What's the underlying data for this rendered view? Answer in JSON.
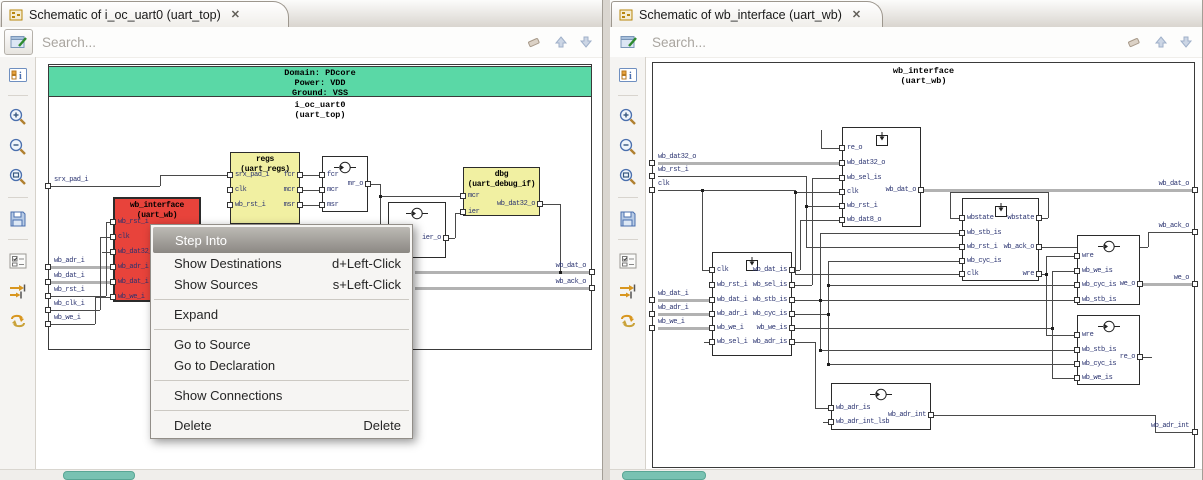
{
  "colors": {
    "banner_green": "#5ad8a6",
    "block_yellow": "#f1f0a2",
    "block_red": "#e8433b",
    "scroll_thumb": "#79c2b2",
    "accent_gold": "#d8961f"
  },
  "left_pane": {
    "tab_title": "Schematic of i_oc_uart0 (uart_top)",
    "close_glyph": "✕",
    "search_placeholder": "Search...",
    "banner": [
      "Domain: PDcore",
      "Power: VDD",
      "Ground: VSS"
    ],
    "instance": [
      "i_oc_uart0",
      "(uart_top)"
    ],
    "edge_in": [
      "srx_pad_i",
      "wb_adr_i",
      "wb_dat_i",
      "wb_rst_i",
      "wb_clk_i",
      "wb_we_i"
    ],
    "edge_out": [
      "wb_dat_o",
      "wb_ack_o"
    ],
    "blocks": {
      "regs": {
        "t": "regs",
        "s": "(uart_regs)",
        "l": [
          "srx_pad_i",
          "clk",
          "wb_rst_i"
        ],
        "r": [
          "fcr",
          "mcr",
          "msr"
        ]
      },
      "clkgen1": {
        "t": "",
        "s": "",
        "l": [
          "fcr",
          "mcr",
          "msr"
        ],
        "r": [
          "mr_o"
        ]
      },
      "clkgen2": {
        "t": "",
        "s": "",
        "l": [],
        "r": [
          "ier_o"
        ]
      },
      "dbg": {
        "t": "dbg",
        "s": "(uart_debug_if)",
        "l": [
          "mcr",
          "ier"
        ],
        "r": [
          "wb_dat32_o"
        ]
      },
      "wb": {
        "t": "wb_interface",
        "s": "(uart_wb)",
        "l": [
          "wb_rst_i",
          "clk",
          "wb_dat32_o",
          "wb_adr_i",
          "wb_dat_i",
          "wb_we_i"
        ],
        "r": []
      }
    },
    "context_menu": {
      "items": [
        {
          "label": "Step Into",
          "accel": "",
          "selected": true
        },
        {
          "label": "Show Destinations",
          "accel": "d+Left-Click"
        },
        {
          "label": "Show Sources",
          "accel": "s+Left-Click"
        },
        {
          "sep": true
        },
        {
          "label": "Expand",
          "accel": ""
        },
        {
          "sep": true
        },
        {
          "label": "Go to Source",
          "accel": ""
        },
        {
          "label": "Go to Declaration",
          "accel": ""
        },
        {
          "sep": true
        },
        {
          "label": "Show Connections",
          "accel": ""
        },
        {
          "sep": true
        },
        {
          "label": "Delete",
          "accel": "Delete"
        }
      ]
    }
  },
  "right_pane": {
    "tab_title": "Schematic of wb_interface (uart_wb)",
    "close_glyph": "✕",
    "search_placeholder": "Search...",
    "title": [
      "wb_interface",
      "(uart_wb)"
    ],
    "edge_in": [
      "wb_dat32_o",
      "wb_rst_i",
      "clk",
      "wb_dat_i",
      "wb_adr_i",
      "wb_we_i"
    ],
    "edge_out": [
      "wb_dat_o",
      "wb_ack_o",
      "we_o",
      "wb_adr_int"
    ],
    "blocks": {
      "top": {
        "t": "",
        "s": "",
        "l": [
          "re_o",
          "wb_dat32_o",
          "wb_sel_is",
          "clk",
          "wb_rst_i",
          "wb_dat8_o"
        ],
        "r": [
          "wb_dat_o"
        ]
      },
      "inreg": {
        "t": "",
        "s": "",
        "l": [
          "clk",
          "wb_rst_i",
          "wb_dat_i",
          "wb_adr_i",
          "wb_we_i",
          "wb_sel_i"
        ],
        "r": [
          "wb_dat_is",
          "wb_sel_is",
          "wb_stb_is",
          "wb_cyc_is",
          "wb_we_is",
          "wb_adr_is"
        ]
      },
      "state": {
        "t": "",
        "s": "",
        "l": [
          "wbstate",
          "wb_stb_is",
          "wb_rst_i",
          "wb_cyc_is",
          "clk"
        ],
        "r": [
          "wbstate",
          "wb_ack_o",
          "wre"
        ]
      },
      "weff": {
        "t": "",
        "s": "",
        "l": [
          "wre",
          "wb_we_is",
          "wb_cyc_is",
          "wb_stb_is"
        ],
        "r": [
          "we_o"
        ]
      },
      "reff": {
        "t": "",
        "s": "",
        "l": [
          "wre",
          "wb_stb_is",
          "wb_cyc_is",
          "wb_we_is"
        ],
        "r": [
          "re_o"
        ]
      },
      "adrff": {
        "t": "",
        "s": "",
        "l": [
          "wb_adr_is",
          "wb_adr_int_lsb"
        ],
        "r": [
          "wb_adr_int"
        ]
      }
    }
  }
}
